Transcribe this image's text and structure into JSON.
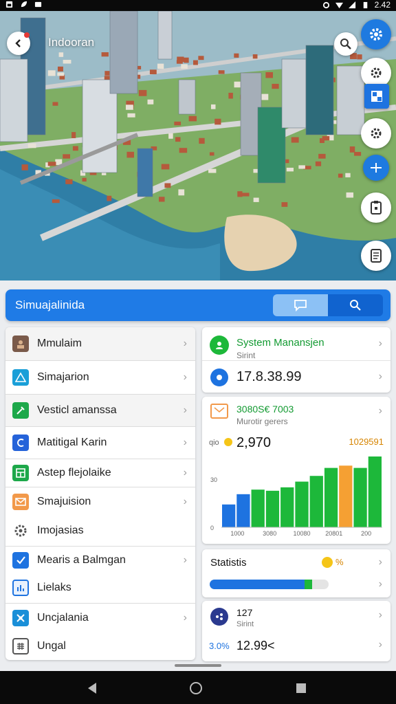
{
  "status_bar": {
    "time": "2.42"
  },
  "hero": {
    "title": "Indooran"
  },
  "toolbar": {
    "title": "Simuajalinida"
  },
  "menu": [
    {
      "label": "Mmulaim",
      "icon": "photo-icon"
    },
    {
      "label": "Simajarion",
      "icon": "triangle-icon"
    },
    {
      "label": "Vesticl amanssa",
      "icon": "wrench-icon"
    },
    {
      "label": "Matitigal Karin",
      "icon": "c-letter-icon"
    },
    {
      "label": "Astep flejolaike",
      "icon": "layout-icon"
    },
    {
      "label": "Smajuision",
      "icon": "mail-icon"
    },
    {
      "label": "Imojasias",
      "icon": "gear-icon"
    },
    {
      "label": "Mearis a Balmgan",
      "icon": "check-icon"
    },
    {
      "label": "Lielaks",
      "icon": "chart-icon"
    },
    {
      "label": "Uncjalania",
      "icon": "satellite-icon"
    },
    {
      "label": "Ungal",
      "icon": "keypad-icon"
    }
  ],
  "system_card": {
    "title": "System Manansjen",
    "subtitle": "Sirint",
    "value": "17.8.38.99"
  },
  "chart_card": {
    "title": "3080S€ 7003",
    "subtitle": "Murotir gerers",
    "value_prefix": "qio",
    "value": "2,970",
    "top_label": "1029591",
    "colors": {
      "blue": "#1e73e0",
      "green": "#1db83a",
      "orange": "#f5a033"
    }
  },
  "chart_data": {
    "type": "bar",
    "ylabel_ticks": [
      "30",
      "0"
    ],
    "x_ticks": [
      "1000",
      "3080",
      "10080",
      "20801",
      "200"
    ],
    "values": [
      20,
      29,
      33,
      32,
      35,
      40,
      45,
      52,
      54,
      52,
      62
    ],
    "bar_colors": [
      "blue",
      "blue",
      "green",
      "green",
      "green",
      "green",
      "green",
      "green",
      "orange",
      "green",
      "green"
    ],
    "ylim": [
      0,
      65
    ]
  },
  "stats_card": {
    "title": "Statistis",
    "badge": "%",
    "progress": 0.8,
    "progress_green": 0.06
  },
  "bottom_card": {
    "title": "127",
    "subtitle": "Sirint",
    "prefix": "3.0%",
    "value": "12.99<"
  }
}
